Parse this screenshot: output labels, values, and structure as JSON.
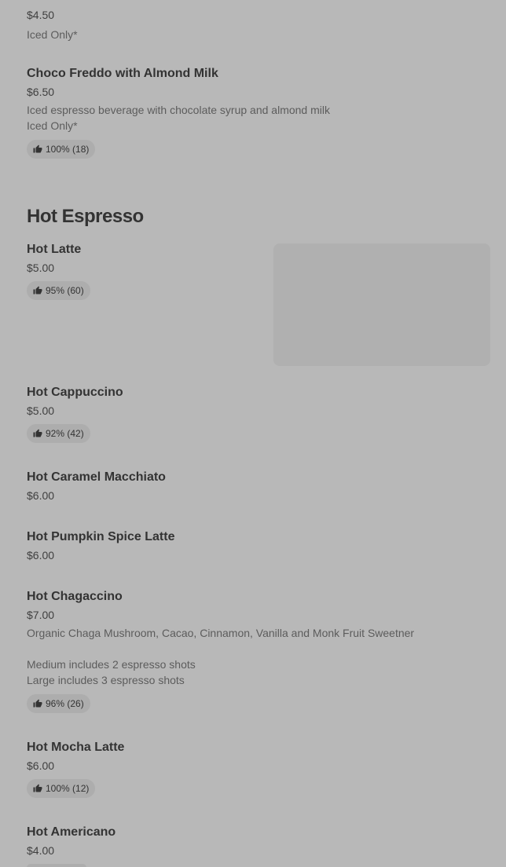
{
  "colors": {
    "background": "#b8b8b8",
    "text": "#333333",
    "muted_text": "#5c5c5c",
    "chip_background": "#adadad"
  },
  "top_items": [
    {
      "price": "$4.50",
      "description": "Iced Only*"
    },
    {
      "name": "Choco Freddo with Almond Milk",
      "price": "$6.50",
      "description": "Iced espresso beverage with chocolate syrup and almond milk\nIced Only*",
      "rating": "100% (18)"
    }
  ],
  "section": {
    "title": "Hot Espresso",
    "items": [
      {
        "name": "Hot Latte",
        "price": "$5.00",
        "rating": "95% (60)"
      },
      {
        "name": "Hot Cappuccino",
        "price": "$5.00",
        "rating": "92% (42)"
      },
      {
        "name": "Hot Caramel Macchiato",
        "price": "$6.00"
      },
      {
        "name": "Hot Pumpkin Spice Latte",
        "price": "$6.00"
      },
      {
        "name": "Hot Chagaccino",
        "price": "$7.00",
        "description": "Organic Chaga Mushroom, Cacao, Cinnamon, Vanilla and Monk Fruit Sweetner",
        "description_2": "Medium includes 2 espresso shots\nLarge includes 3 espresso shots",
        "rating": "96% (26)"
      },
      {
        "name": "Hot Mocha Latte",
        "price": "$6.00",
        "rating": "100% (12)"
      },
      {
        "name": "Hot Americano",
        "price": "$4.00"
      }
    ]
  },
  "icons": {
    "rating": "thumbs-up-icon",
    "item_image": "image-placeholder"
  }
}
